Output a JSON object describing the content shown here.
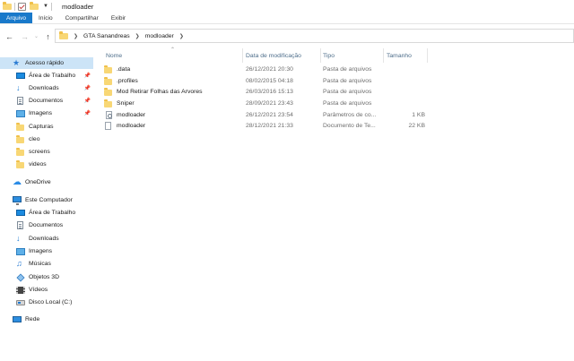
{
  "window": {
    "title": "modloader"
  },
  "ribbon": {
    "tabs": [
      "Arquivo",
      "Início",
      "Compartilhar",
      "Exibir"
    ]
  },
  "address": {
    "crumbs": [
      "GTA Sanandreas",
      "modloader"
    ]
  },
  "sidebar": {
    "quick_access": {
      "label": "Acesso rápido",
      "items": [
        {
          "label": "Área de Trabalho",
          "icon": "desktop-icon",
          "pinned": true
        },
        {
          "label": "Downloads",
          "icon": "download-icon",
          "pinned": true
        },
        {
          "label": "Documentos",
          "icon": "document-icon",
          "pinned": true
        },
        {
          "label": "Imagens",
          "icon": "pictures-icon",
          "pinned": true
        },
        {
          "label": "Capturas",
          "icon": "folder-icon",
          "pinned": false
        },
        {
          "label": "cleo",
          "icon": "folder-icon",
          "pinned": false
        },
        {
          "label": "screens",
          "icon": "folder-icon",
          "pinned": false
        },
        {
          "label": "videos",
          "icon": "folder-icon",
          "pinned": false
        }
      ]
    },
    "onedrive": {
      "label": "OneDrive"
    },
    "this_pc": {
      "label": "Este Computador",
      "items": [
        {
          "label": "Área de Trabalho",
          "icon": "desktop-icon"
        },
        {
          "label": "Documentos",
          "icon": "document-icon"
        },
        {
          "label": "Downloads",
          "icon": "download-icon"
        },
        {
          "label": "Imagens",
          "icon": "pictures-icon"
        },
        {
          "label": "Músicas",
          "icon": "music-icon"
        },
        {
          "label": "Objetos 3D",
          "icon": "objects-3d-icon"
        },
        {
          "label": "Vídeos",
          "icon": "videos-icon"
        },
        {
          "label": "Disco Local (C:)",
          "icon": "disk-icon"
        }
      ]
    },
    "network": {
      "label": "Rede"
    }
  },
  "file_list": {
    "columns": [
      "Nome",
      "Data de modificação",
      "Tipo",
      "Tamanho"
    ],
    "rows": [
      {
        "name": ".data",
        "date": "26/12/2021 20:30",
        "type": "Pasta de arquivos",
        "size": "",
        "kind": "folder"
      },
      {
        "name": ".profiles",
        "date": "08/02/2015 04:18",
        "type": "Pasta de arquivos",
        "size": "",
        "kind": "folder"
      },
      {
        "name": "Mod Retirar Folhas das Arvores",
        "date": "26/03/2016 15:13",
        "type": "Pasta de arquivos",
        "size": "",
        "kind": "folder"
      },
      {
        "name": "Sniper",
        "date": "28/09/2021 23:43",
        "type": "Pasta de arquivos",
        "size": "",
        "kind": "folder"
      },
      {
        "name": "modloader",
        "date": "26/12/2021 23:54",
        "type": "Parâmetros de co...",
        "size": "1 KB",
        "kind": "settings"
      },
      {
        "name": "modloader",
        "date": "28/12/2021 21:33",
        "type": "Documento de Te...",
        "size": "22 KB",
        "kind": "text"
      }
    ]
  }
}
